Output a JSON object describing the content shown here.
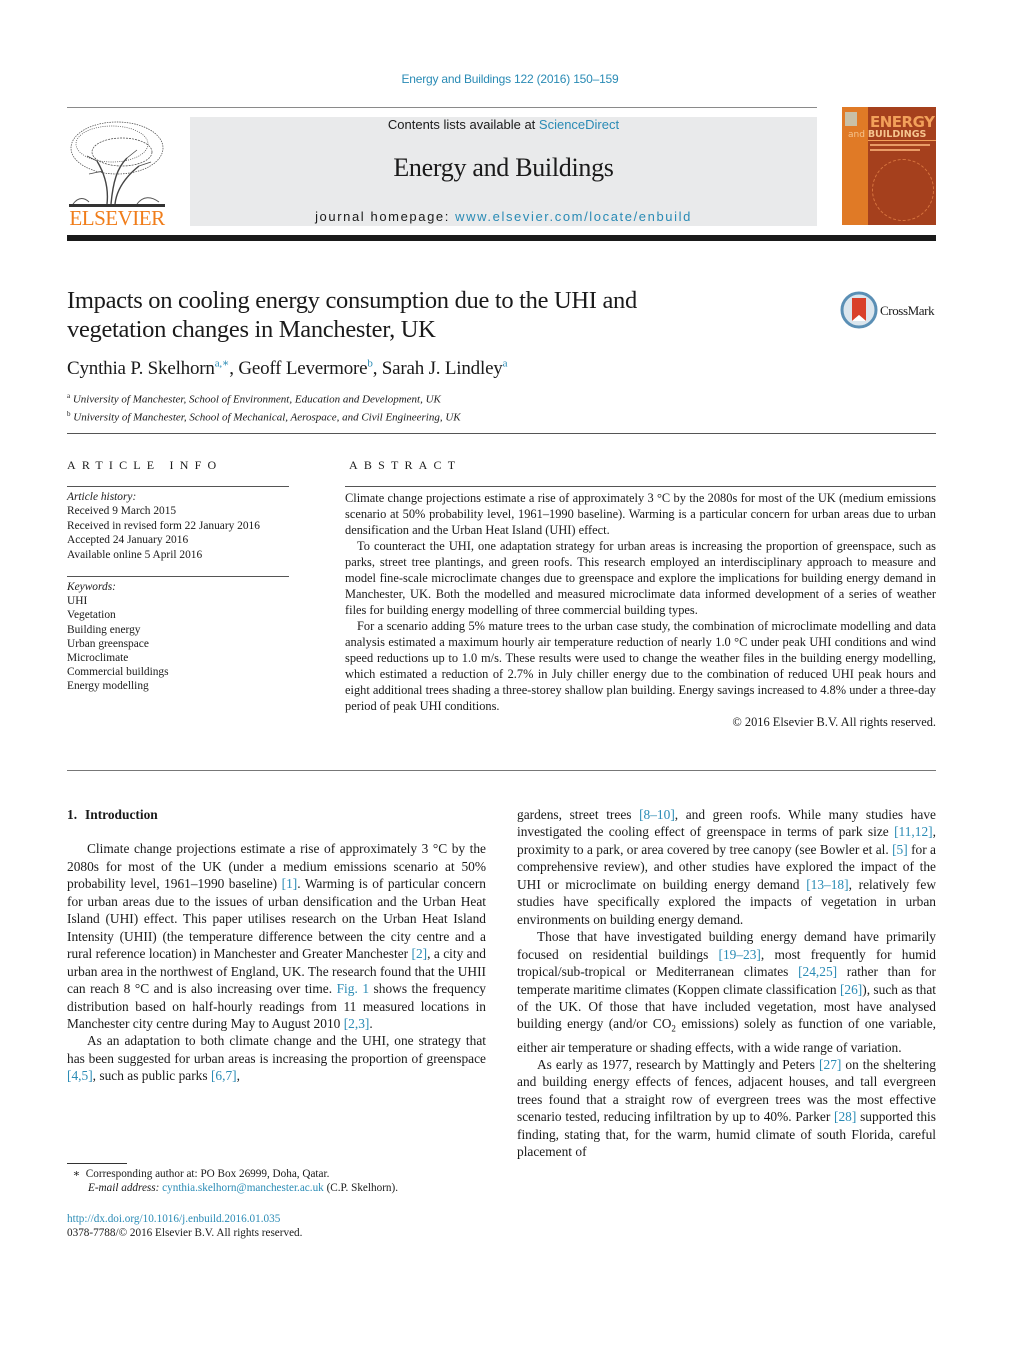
{
  "header": {
    "journal_ref": "Energy and Buildings 122 (2016) 150–159",
    "publisher_logo_text": "ELSEVIER",
    "contents_prefix": "Contents lists available at ",
    "contents_link": "ScienceDirect",
    "journal_title": "Energy and Buildings",
    "homepage_prefix": "journal homepage: ",
    "homepage_link": "www.elsevier.com/locate/enbuild",
    "cover": {
      "line1": "ENERGY",
      "line2_small": "and",
      "line2": "BUILDINGS"
    },
    "colors": {
      "link": "#2a8bb5",
      "elsevier_orange": "#f07d1a",
      "cover_brown": "#a5401d",
      "cover_orange": "#e07a26",
      "banner_gray": "#e9eaeb"
    }
  },
  "article": {
    "title_line1": "Impacts on cooling energy consumption due to the UHI and",
    "title_line2": "vegetation changes in Manchester, UK",
    "crossmark_label": "CrossMark",
    "authors": [
      {
        "name": "Cynthia P. Skelhorn",
        "sup": "a,∗",
        "sep": ", "
      },
      {
        "name": "Geoff Levermore",
        "sup": "b",
        "sep": ", "
      },
      {
        "name": "Sarah J. Lindley",
        "sup": "a",
        "sep": ""
      }
    ],
    "affiliations": [
      {
        "key": "a",
        "text": "University of Manchester, School of Environment, Education and Development, UK"
      },
      {
        "key": "b",
        "text": "University of Manchester, School of Mechanical, Aerospace, and Civil Engineering, UK"
      }
    ]
  },
  "article_info": {
    "heading": "ARTICLE INFO",
    "history_label": "Article history:",
    "history": [
      "Received 9 March 2015",
      "Received in revised form 22 January 2016",
      "Accepted 24 January 2016",
      "Available online 5 April 2016"
    ],
    "keywords_label": "Keywords:",
    "keywords": [
      "UHI",
      "Vegetation",
      "Building energy",
      "Urban greenspace",
      "Microclimate",
      "Commercial buildings",
      "Energy modelling"
    ]
  },
  "abstract": {
    "heading": "ABSTRACT",
    "paragraphs": [
      "Climate change projections estimate a rise of approximately 3 °C by the 2080s for most of the UK (medium emissions scenario at 50% probability level, 1961–1990 baseline). Warming is a particular concern for urban areas due to urban densification and the Urban Heat Island (UHI) effect.",
      "To counteract the UHI, one adaptation strategy for urban areas is increasing the proportion of greenspace, such as parks, street tree plantings, and green roofs. This research employed an interdisciplinary approach to measure and model fine-scale microclimate changes due to greenspace and explore the implications for building energy demand in Manchester, UK. Both the modelled and measured microclimate data informed development of a series of weather files for building energy modelling of three commercial building types.",
      "For a scenario adding 5% mature trees to the urban case study, the combination of microclimate modelling and data analysis estimated a maximum hourly air temperature reduction of nearly 1.0 °C under peak UHI conditions and wind speed reductions up to 1.0 m/s. These results were used to change the weather files in the building energy modelling, which estimated a reduction of 2.7% in July chiller energy due to the combination of reduced UHI peak hours and eight additional trees shading a three-storey shallow plan building. Energy savings increased to 4.8% under a three-day period of peak UHI conditions."
    ],
    "copyright": "© 2016 Elsevier B.V. All rights reserved."
  },
  "introduction": {
    "number": "1.",
    "heading": "Introduction",
    "left_p1": [
      {
        "t": "Climate change projections estimate a rise of approximately 3 °C by the 2080s for most of the UK (under a medium emissions scenario at 50% probability level, 1961–1990 baseline) "
      },
      {
        "ref": "[1]"
      },
      {
        "t": ". Warming is of particular concern for urban areas due to the issues of urban densification and the Urban Heat Island (UHI) effect. This paper utilises research on the Urban Heat Island Intensity (UHII) (the temperature difference between the city centre and a rural reference location) in Manchester and Greater Manchester "
      },
      {
        "ref": "[2]"
      },
      {
        "t": ", a city and urban area in the northwest of England, UK. The research found that the UHII can reach 8 °C and is also increasing over time. "
      },
      {
        "ref": "Fig. 1"
      },
      {
        "t": " shows the frequency distribution based on half-hourly readings from 11 measured locations in Manchester city centre during May to August 2010 "
      },
      {
        "ref": "[2,3]"
      },
      {
        "t": "."
      }
    ],
    "left_p2": [
      {
        "t": "As an adaptation to both climate change and the UHI, one strategy that has been suggested for urban areas is increasing the proportion of greenspace "
      },
      {
        "ref": "[4,5]"
      },
      {
        "t": ", such as public parks "
      },
      {
        "ref": "[6,7]"
      },
      {
        "t": ","
      }
    ],
    "right_p1": [
      {
        "t": "gardens, street trees "
      },
      {
        "ref": "[8–10]"
      },
      {
        "t": ", and green roofs. While many studies have investigated the cooling effect of greenspace in terms of park size "
      },
      {
        "ref": "[11,12]"
      },
      {
        "t": ", proximity to a park, or area covered by tree canopy (see Bowler et al. "
      },
      {
        "ref": "[5]"
      },
      {
        "t": " for a comprehensive review), and other studies have explored the impact of the UHI or microclimate on building energy demand "
      },
      {
        "ref": "[13–18]"
      },
      {
        "t": ", relatively few studies have specifically explored the impacts of vegetation in urban environments on building energy demand."
      }
    ],
    "right_p2": [
      {
        "t": "Those that have investigated building energy demand have primarily focused on residential buildings "
      },
      {
        "ref": "[19–23]"
      },
      {
        "t": ", most frequently for humid tropical/sub-tropical or Mediterranean climates "
      },
      {
        "ref": "[24,25]"
      },
      {
        "t": " rather than for temperate maritime climates (Koppen climate classification "
      },
      {
        "ref": "[26]"
      },
      {
        "t": "), such as that of the UK. Of those that have included vegetation, most have analysed building energy (and/or CO"
      },
      {
        "sub": "2"
      },
      {
        "t": " emissions) solely as function of one variable, either air temperature or shading effects, with a wide range of variation."
      }
    ],
    "right_p3": [
      {
        "t": "As early as 1977, research by Mattingly and Peters "
      },
      {
        "ref": "[27]"
      },
      {
        "t": " on the sheltering and building energy effects of fences, adjacent houses, and tall evergreen trees found that a straight row of evergreen trees was the most effective scenario tested, reducing infiltration by up to 40%. Parker "
      },
      {
        "ref": "[28]"
      },
      {
        "t": " supported this finding, stating that, for the warm, humid climate of south Florida, careful placement of"
      }
    ]
  },
  "footnote": {
    "star": "∗",
    "corresponding": "Corresponding author at: PO Box 26999, Doha, Qatar.",
    "email_label": "E-mail address:",
    "email": "cynthia.skelhorn@manchester.ac.uk",
    "email_suffix": " (C.P. Skelhorn).",
    "doi": "http://dx.doi.org/10.1016/j.enbuild.2016.01.035",
    "issn_copyright": "0378-7788/© 2016 Elsevier B.V. All rights reserved."
  }
}
